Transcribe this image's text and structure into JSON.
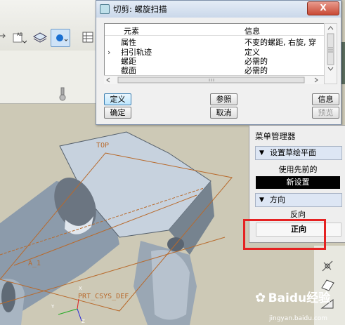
{
  "dialog": {
    "title": "切剪: 螺旋扫描",
    "close_label": "X",
    "columns": [
      "元素",
      "信息"
    ],
    "rows": [
      {
        "element": "属性",
        "info": "不变的螺距, 右旋, 穿"
      },
      {
        "element": "扫引轨迹",
        "info": "定义",
        "current": true
      },
      {
        "element": "螺距",
        "info": "必需的"
      },
      {
        "element": "截面",
        "info": "必需的"
      }
    ],
    "buttons": {
      "define": "定义",
      "reference": "参照",
      "info": "信息",
      "ok": "确定",
      "cancel": "取消",
      "preview": "预览"
    }
  },
  "menu_manager": {
    "title": "菜单管理器",
    "section1": "设置草绘平面",
    "use_previous": "使用先前的",
    "new_setting": "新设置",
    "section2": "方向",
    "reverse": "反向",
    "forward": "正向"
  },
  "viewport": {
    "label_top": "TOP",
    "label_a1": "A_1",
    "label_csys": "PRT_CSYS_DEF",
    "axis_y": "Y",
    "axis_x": "X",
    "axis_z": "Z"
  },
  "watermark": {
    "brand": "Baidu经验",
    "url": "jingyan.baidu.com"
  },
  "colors": {
    "highlight": "#e52222",
    "datum": "#b86a2c",
    "menu_active": "#000000"
  }
}
